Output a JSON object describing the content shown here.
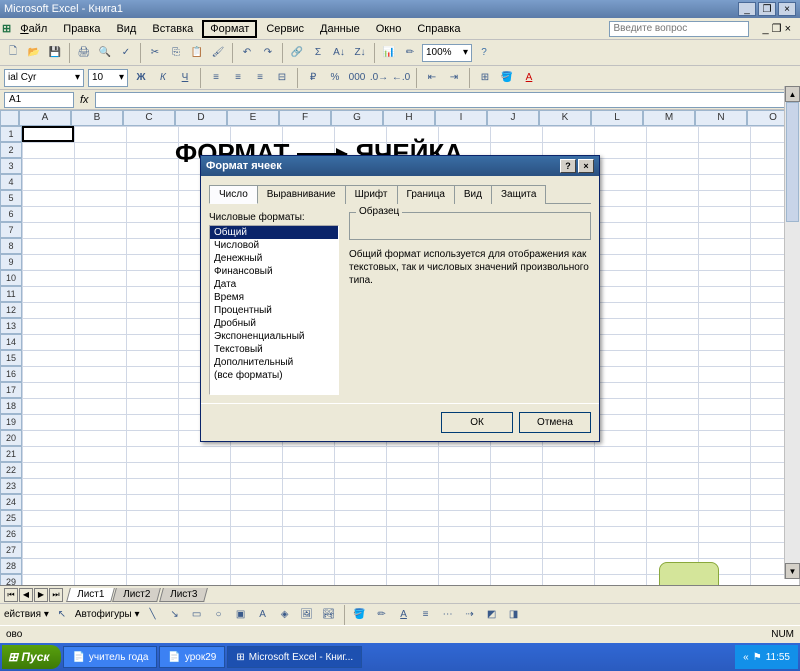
{
  "app": {
    "title": "Microsoft Excel - Книга1"
  },
  "menubar": {
    "file": "Файл",
    "edit": "Правка",
    "view": "Вид",
    "insert": "Вставка",
    "format": "Формат",
    "tools": "Сервис",
    "data": "Данные",
    "window": "Окно",
    "help": "Справка",
    "question_placeholder": "Введите вопрос"
  },
  "toolbar2": {
    "font_name": "ial Cyr",
    "font_size": "10",
    "zoom": "100%"
  },
  "fbar": {
    "namebox": "A1",
    "fx": "fx"
  },
  "columns": [
    "A",
    "B",
    "C",
    "D",
    "E",
    "F",
    "G",
    "H",
    "I",
    "J",
    "K",
    "L",
    "M",
    "N",
    "O"
  ],
  "overlay": {
    "word1": "ФОРМАТ",
    "word2": "ЯЧЕЙКА"
  },
  "dialog": {
    "title": "Формат ячеек",
    "tabs": [
      "Число",
      "Выравнивание",
      "Шрифт",
      "Граница",
      "Вид",
      "Защита"
    ],
    "active_tab": 0,
    "list_label": "Числовые форматы:",
    "formats": [
      "Общий",
      "Числовой",
      "Денежный",
      "Финансовый",
      "Дата",
      "Время",
      "Процентный",
      "Дробный",
      "Экспоненциальный",
      "Текстовый",
      "Дополнительный",
      "(все форматы)"
    ],
    "selected_format": 0,
    "sample_label": "Образец",
    "description": "Общий формат используется для отображения как текстовых, так и числовых значений произвольного типа.",
    "ok": "ОК",
    "cancel": "Отмена"
  },
  "worksheet_tabs": [
    "Лист1",
    "Лист2",
    "Лист3"
  ],
  "drawbar": {
    "actions": "ействия",
    "autoshapes": "Автофигуры"
  },
  "status": {
    "left": "ово",
    "num": "NUM"
  },
  "taskbar": {
    "start": "Пуск",
    "items": [
      "учитель года",
      "урок29",
      "Microsoft Excel - Книг..."
    ],
    "clock": "11:55"
  }
}
